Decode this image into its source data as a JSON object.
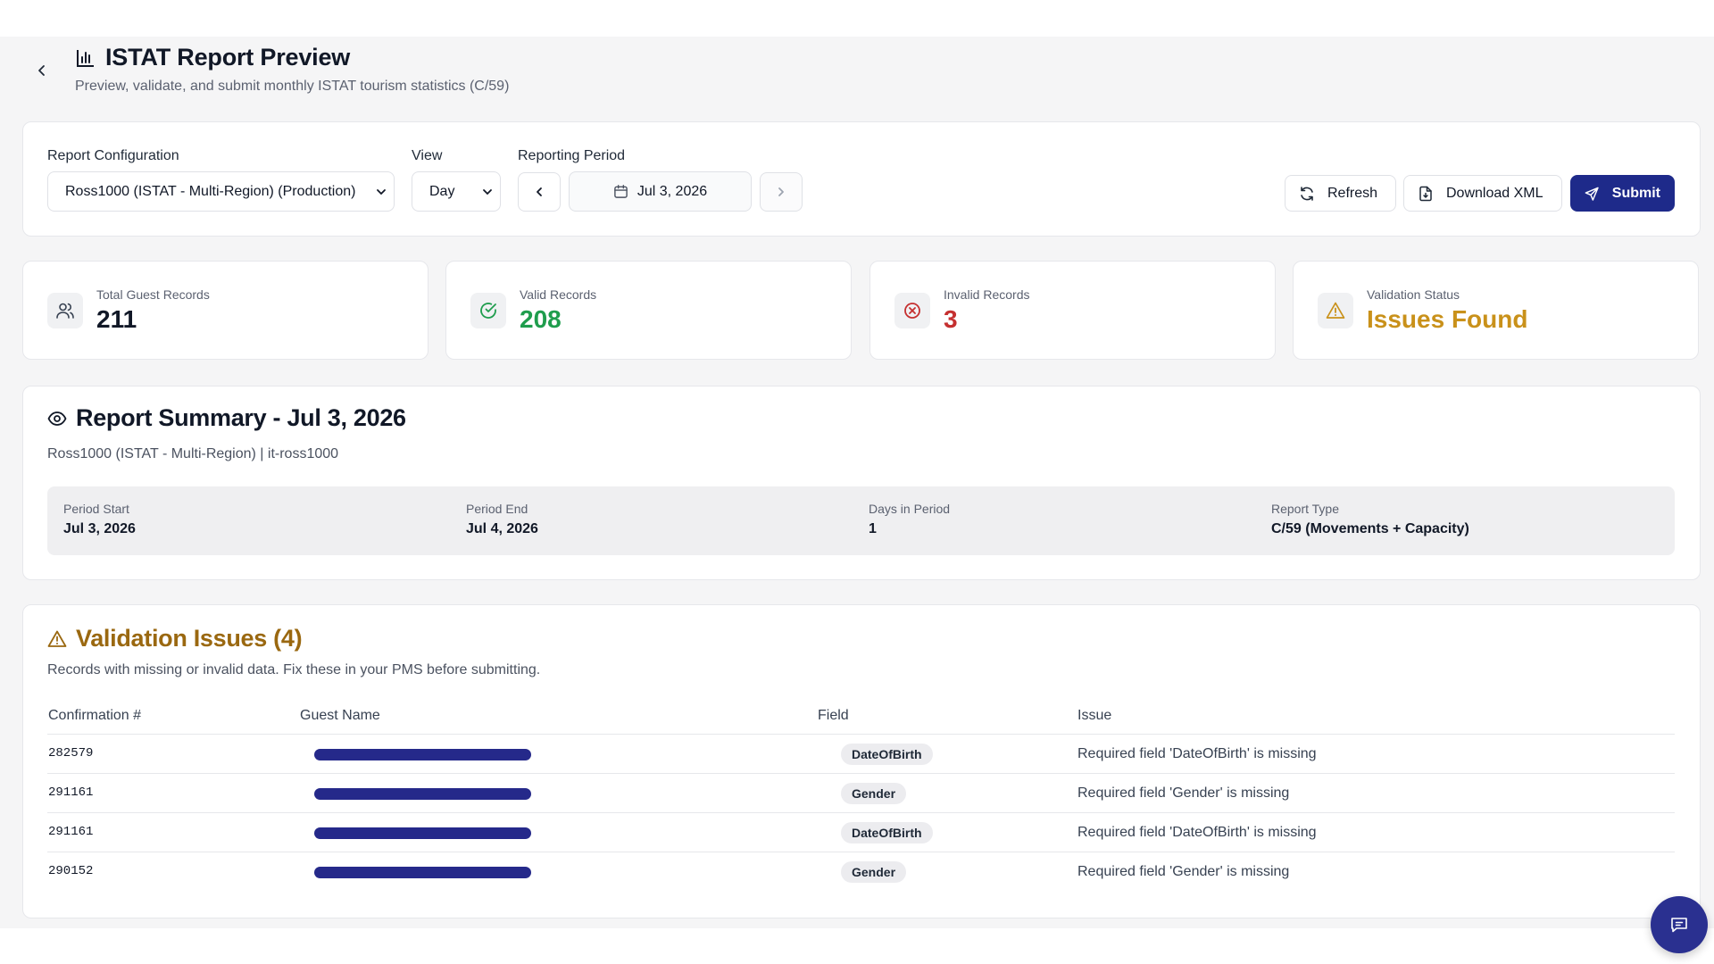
{
  "header": {
    "title": "ISTAT Report Preview",
    "subtitle": "Preview, validate, and submit monthly ISTAT tourism statistics (C/59)"
  },
  "config": {
    "report_configuration_label": "Report Configuration",
    "report_configuration_value": "Ross1000 (ISTAT - Multi-Region) (Production)",
    "view_label": "View",
    "view_value": "Day",
    "reporting_period_label": "Reporting Period",
    "reporting_period_value": "Jul 3, 2026",
    "refresh_label": "Refresh",
    "download_label": "Download XML",
    "submit_label": "Submit"
  },
  "stats": [
    {
      "label": "Total Guest Records",
      "value": "211",
      "icon": "users-icon",
      "color": "#111827"
    },
    {
      "label": "Valid Records",
      "value": "208",
      "icon": "check-circle-icon",
      "color": "#1f9d4d"
    },
    {
      "label": "Invalid Records",
      "value": "3",
      "icon": "x-circle-icon",
      "color": "#c53030"
    },
    {
      "label": "Validation Status",
      "value": "Issues Found",
      "icon": "warning-icon",
      "color": "#c9911a"
    }
  ],
  "summary": {
    "title": "Report Summary - Jul 3, 2026",
    "subtitle": "Ross1000 (ISTAT - Multi-Region) | it-ross1000",
    "items": [
      {
        "label": "Period Start",
        "value": "Jul 3, 2026"
      },
      {
        "label": "Period End",
        "value": "Jul 4, 2026"
      },
      {
        "label": "Days in Period",
        "value": "1"
      },
      {
        "label": "Report Type",
        "value": "C/59 (Movements + Capacity)"
      }
    ]
  },
  "issues": {
    "title": "Validation Issues (4)",
    "subtitle": "Records with missing or invalid data. Fix these in your PMS before submitting.",
    "columns": [
      "Confirmation #",
      "Guest Name",
      "Field",
      "Issue"
    ],
    "rows": [
      {
        "confirmation": "282579",
        "field": "DateOfBirth",
        "issue": "Required field 'DateOfBirth' is missing"
      },
      {
        "confirmation": "291161",
        "field": "Gender",
        "issue": "Required field 'Gender' is missing"
      },
      {
        "confirmation": "291161",
        "field": "DateOfBirth",
        "issue": "Required field 'DateOfBirth' is missing"
      },
      {
        "confirmation": "290152",
        "field": "Gender",
        "issue": "Required field 'Gender' is missing"
      }
    ]
  },
  "colors": {
    "primary": "#1e2a8a",
    "warning": "#9a6810",
    "success": "#1f9d4d",
    "danger": "#c53030"
  }
}
